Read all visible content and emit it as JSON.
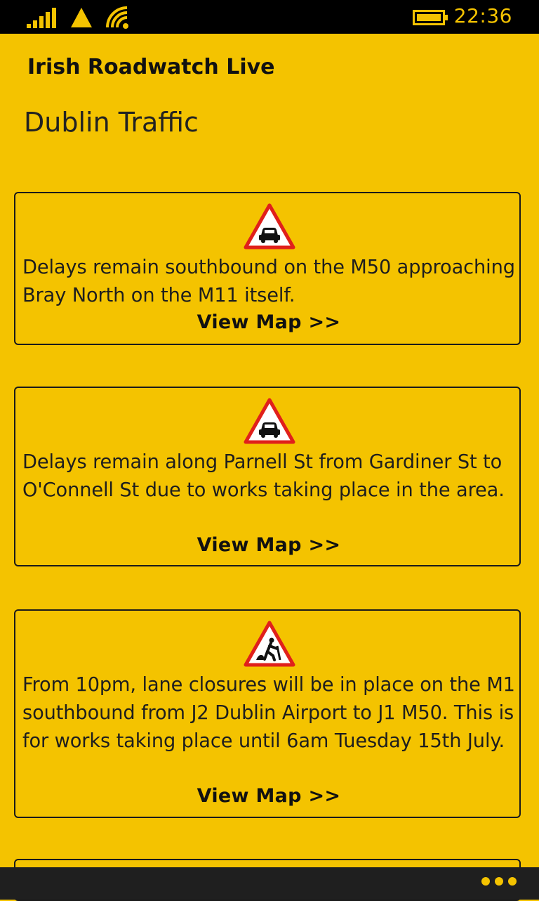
{
  "status_bar": {
    "time": "22:36",
    "icons": [
      "signal-strength-icon",
      "warning-triangle-icon",
      "wifi-icon",
      "battery-icon"
    ],
    "accent_color": "#f4c300"
  },
  "app": {
    "title": "Irish Roadwatch Live",
    "page_title": "Dublin Traffic",
    "background_color": "#f4c300"
  },
  "incidents": [
    {
      "icon": "car-warning-sign-icon",
      "text": "Delays remain southbound on the M50 approaching Bray North on the M11 itself.",
      "link_label": "View Map >>"
    },
    {
      "icon": "car-warning-sign-icon",
      "text": "Delays remain along Parnell St from Gardiner St to O'Connell St due to works taking place in the area.",
      "link_label": "View Map >>"
    },
    {
      "icon": "roadworks-sign-icon",
      "text": "From 10pm, lane closures will be in place on the M1 southbound from J2 Dublin Airport to J1 M50. This is for works taking place until 6am Tuesday 15th July.",
      "link_label": "View Map >>"
    }
  ],
  "app_bar": {
    "icon": "more-options-icon"
  }
}
